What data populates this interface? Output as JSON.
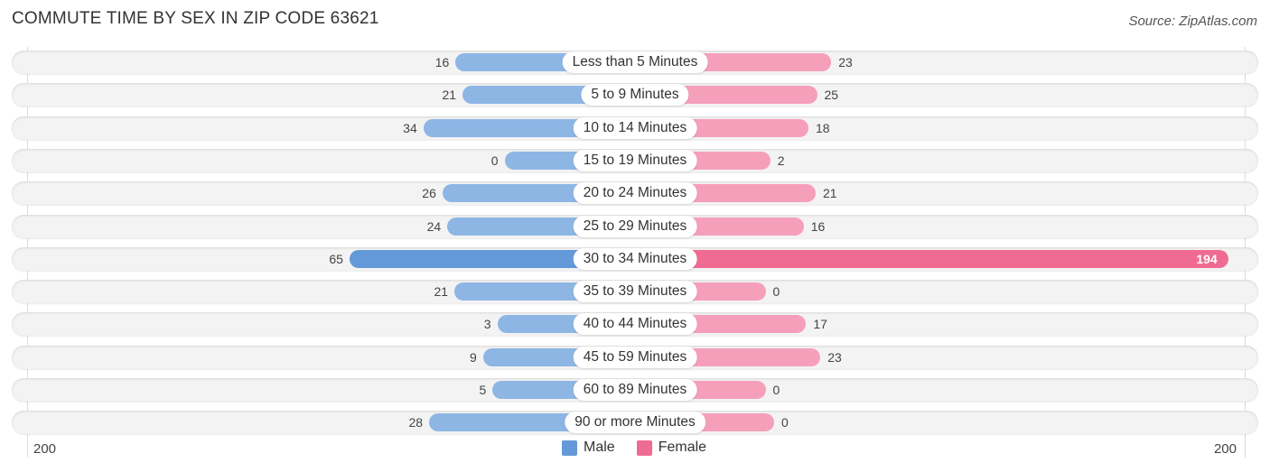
{
  "title": "COMMUTE TIME BY SEX IN ZIP CODE 63621",
  "source": "Source: ZipAtlas.com",
  "colors": {
    "male": "#8db6e5",
    "male_strong": "#6399d9",
    "female": "#f59fbb",
    "female_strong": "#f06b93"
  },
  "chart_data": {
    "type": "bar",
    "orientation": "horizontal-diverging",
    "title": "COMMUTE TIME BY SEX IN ZIP CODE 63621",
    "categories": [
      "Less than 5 Minutes",
      "5 to 9 Minutes",
      "10 to 14 Minutes",
      "15 to 19 Minutes",
      "20 to 24 Minutes",
      "25 to 29 Minutes",
      "30 to 34 Minutes",
      "35 to 39 Minutes",
      "40 to 44 Minutes",
      "45 to 59 Minutes",
      "60 to 89 Minutes",
      "90 or more Minutes"
    ],
    "series": [
      {
        "name": "Male",
        "values": [
          16,
          21,
          34,
          0,
          26,
          24,
          65,
          21,
          3,
          9,
          5,
          28
        ]
      },
      {
        "name": "Female",
        "values": [
          23,
          25,
          18,
          2,
          21,
          16,
          194,
          0,
          17,
          23,
          0,
          0
        ]
      }
    ],
    "xlim": [
      -200,
      200
    ],
    "axis_labels": {
      "left": "200",
      "right": "200"
    },
    "legend": {
      "position": "bottom-center",
      "entries": [
        "Male",
        "Female"
      ]
    },
    "grid": false
  }
}
